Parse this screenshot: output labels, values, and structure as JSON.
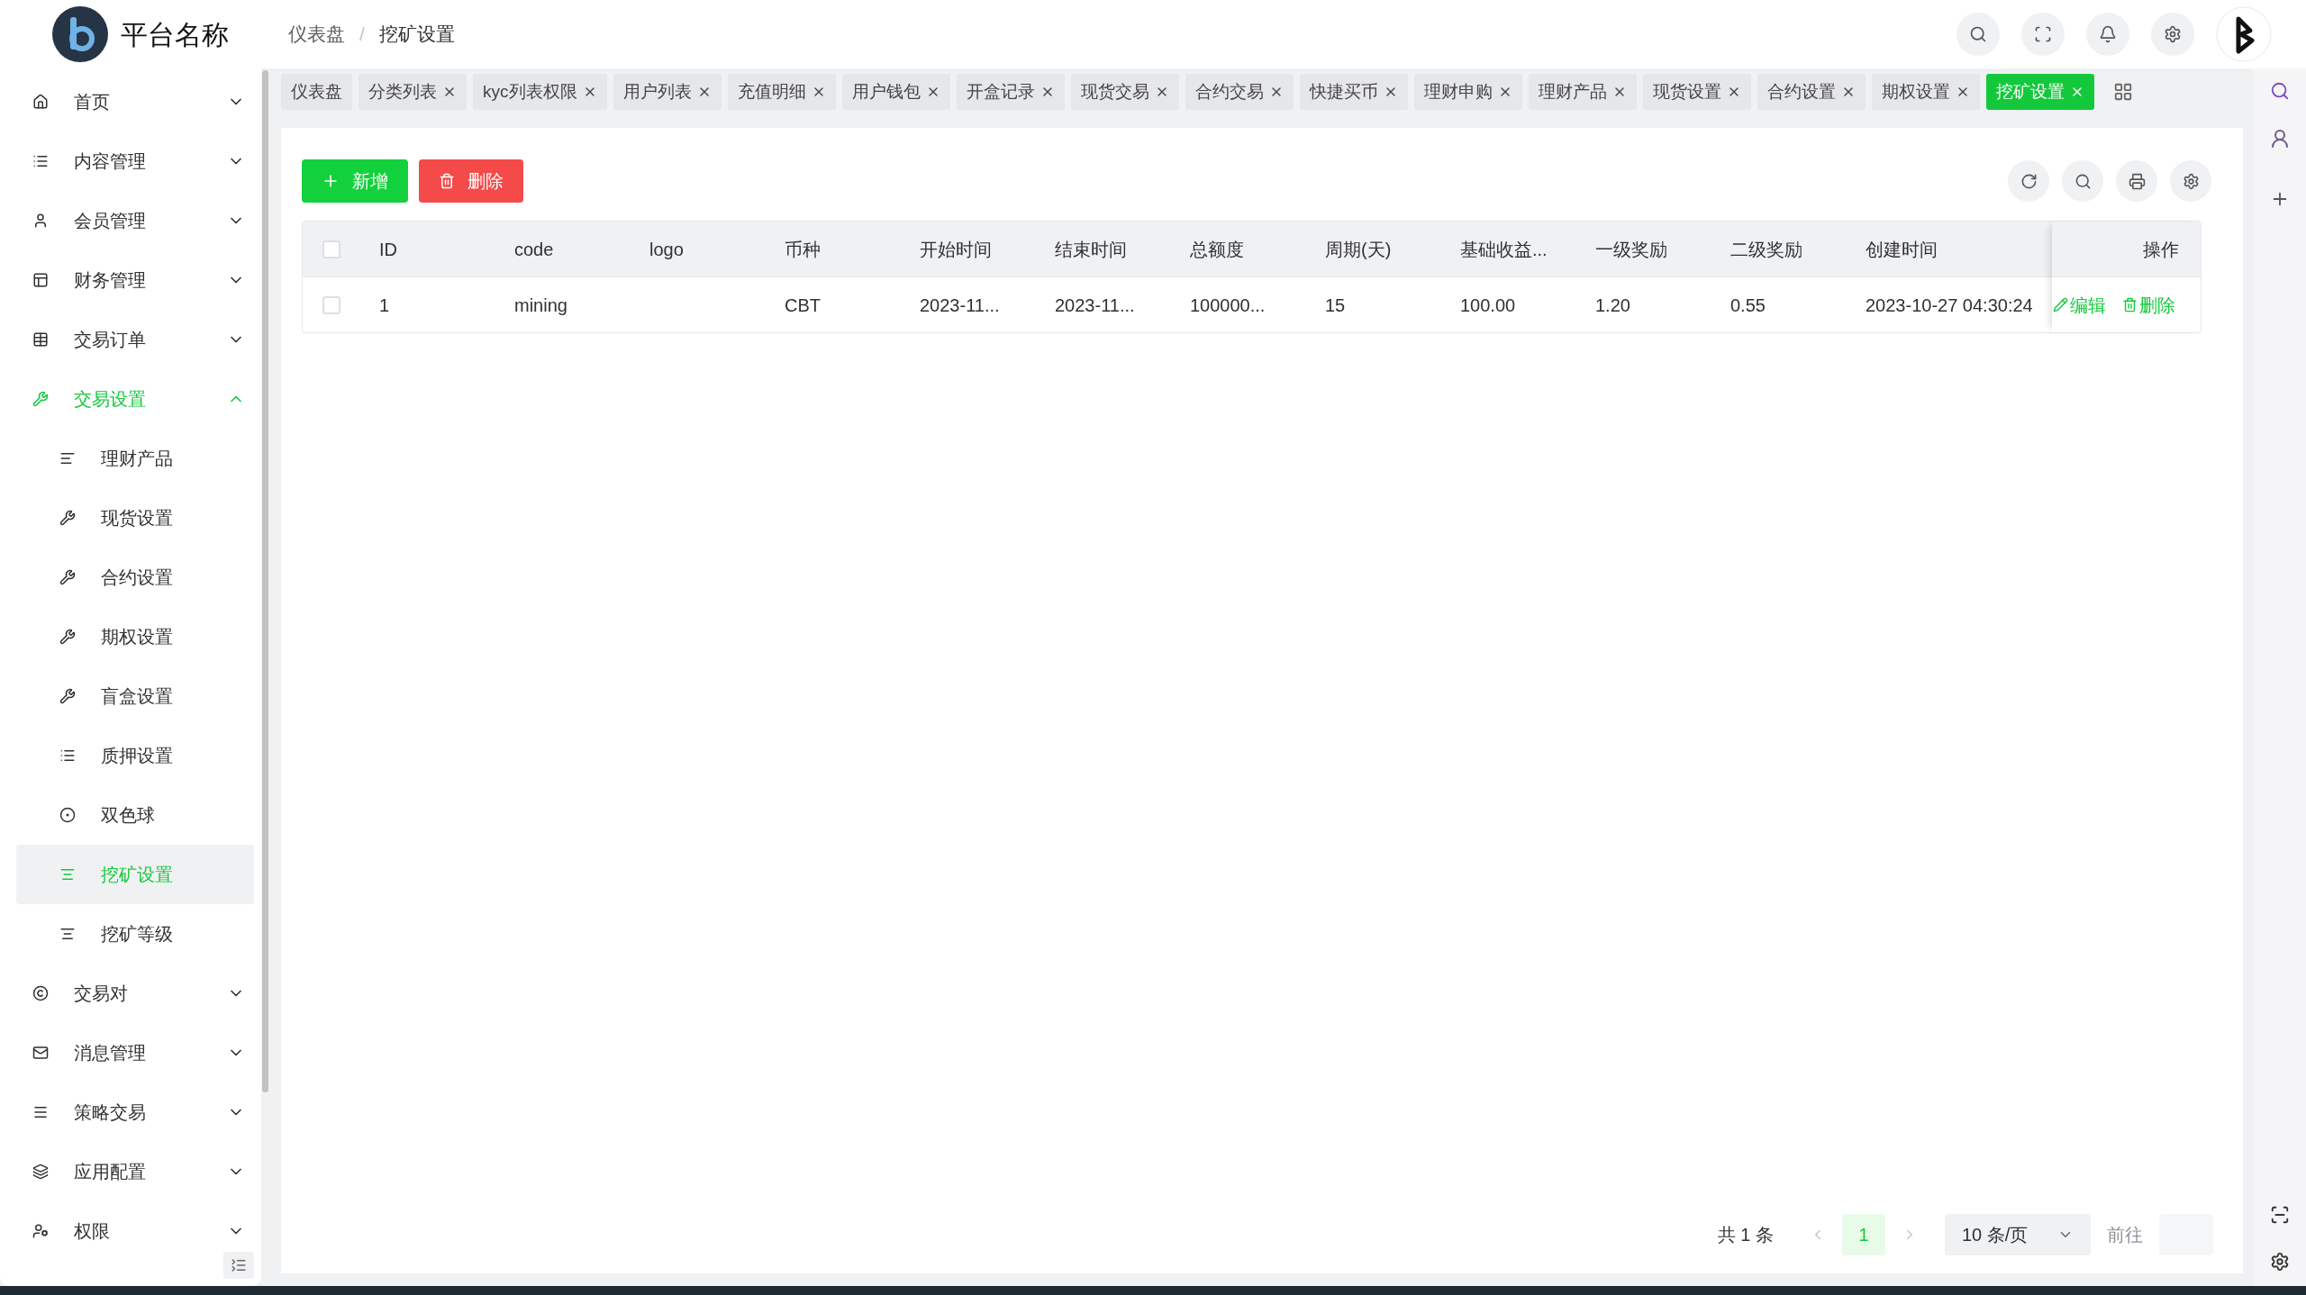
{
  "header": {
    "title": "平台名称",
    "breadcrumb": [
      "仪表盘",
      "挖矿设置"
    ],
    "breadcrumb_separator": "/"
  },
  "sidebar": {
    "items": [
      {
        "label": "首页",
        "expanded": false
      },
      {
        "label": "内容管理",
        "expanded": false
      },
      {
        "label": "会员管理",
        "expanded": false
      },
      {
        "label": "财务管理",
        "expanded": false
      },
      {
        "label": "交易订单",
        "expanded": false
      },
      {
        "label": "交易设置",
        "expanded": true,
        "children": [
          {
            "label": "理财产品",
            "selected": false
          },
          {
            "label": "现货设置",
            "selected": false
          },
          {
            "label": "合约设置",
            "selected": false
          },
          {
            "label": "期权设置",
            "selected": false
          },
          {
            "label": "盲盒设置",
            "selected": false
          },
          {
            "label": "质押设置",
            "selected": false
          },
          {
            "label": "双色球",
            "selected": false
          },
          {
            "label": "挖矿设置",
            "selected": true
          },
          {
            "label": "挖矿等级",
            "selected": false
          }
        ]
      },
      {
        "label": "交易对",
        "expanded": false
      },
      {
        "label": "消息管理",
        "expanded": false
      },
      {
        "label": "策略交易",
        "expanded": false
      },
      {
        "label": "应用配置",
        "expanded": false
      },
      {
        "label": "权限",
        "expanded": false
      }
    ]
  },
  "tabs": [
    {
      "label": "仪表盘",
      "selected": false,
      "closable": false
    },
    {
      "label": "分类列表",
      "selected": false,
      "closable": true
    },
    {
      "label": "kyc列表权限",
      "selected": false,
      "closable": true
    },
    {
      "label": "用户列表",
      "selected": false,
      "closable": true
    },
    {
      "label": "充值明细",
      "selected": false,
      "closable": true
    },
    {
      "label": "用户钱包",
      "selected": false,
      "closable": true
    },
    {
      "label": "开盒记录",
      "selected": false,
      "closable": true
    },
    {
      "label": "现货交易",
      "selected": false,
      "closable": true
    },
    {
      "label": "合约交易",
      "selected": false,
      "closable": true
    },
    {
      "label": "快捷买币",
      "selected": false,
      "closable": true
    },
    {
      "label": "理财申购",
      "selected": false,
      "closable": true
    },
    {
      "label": "理财产品",
      "selected": false,
      "closable": true
    },
    {
      "label": "现货设置",
      "selected": false,
      "closable": true
    },
    {
      "label": "合约设置",
      "selected": false,
      "closable": true
    },
    {
      "label": "期权设置",
      "selected": false,
      "closable": true
    },
    {
      "label": "挖矿设置",
      "selected": true,
      "closable": true
    }
  ],
  "toolbar": {
    "add_button": "新增",
    "delete_button": "删除"
  },
  "table": {
    "header_checked": false,
    "columns": [
      "ID",
      "code",
      "logo",
      "币种",
      "开始时间",
      "结束时间",
      "总额度",
      "周期(天)",
      "基础收益...",
      "一级奖励",
      "二级奖励",
      "创建时间",
      "操作"
    ],
    "rows": [
      {
        "checked": false,
        "cells": [
          "1",
          "mining",
          "",
          "CBT",
          "2023-11...",
          "2023-11...",
          "100000...",
          "15",
          "100.00",
          "1.20",
          "0.55",
          "2023-10-27 04:30:24"
        ],
        "actions": [
          "编辑",
          "删除"
        ]
      }
    ]
  },
  "pagination": {
    "total": "共 1 条",
    "pages": [
      {
        "label": "1",
        "selected": true
      }
    ],
    "page_size": "10 条/页",
    "goto": "前往"
  }
}
